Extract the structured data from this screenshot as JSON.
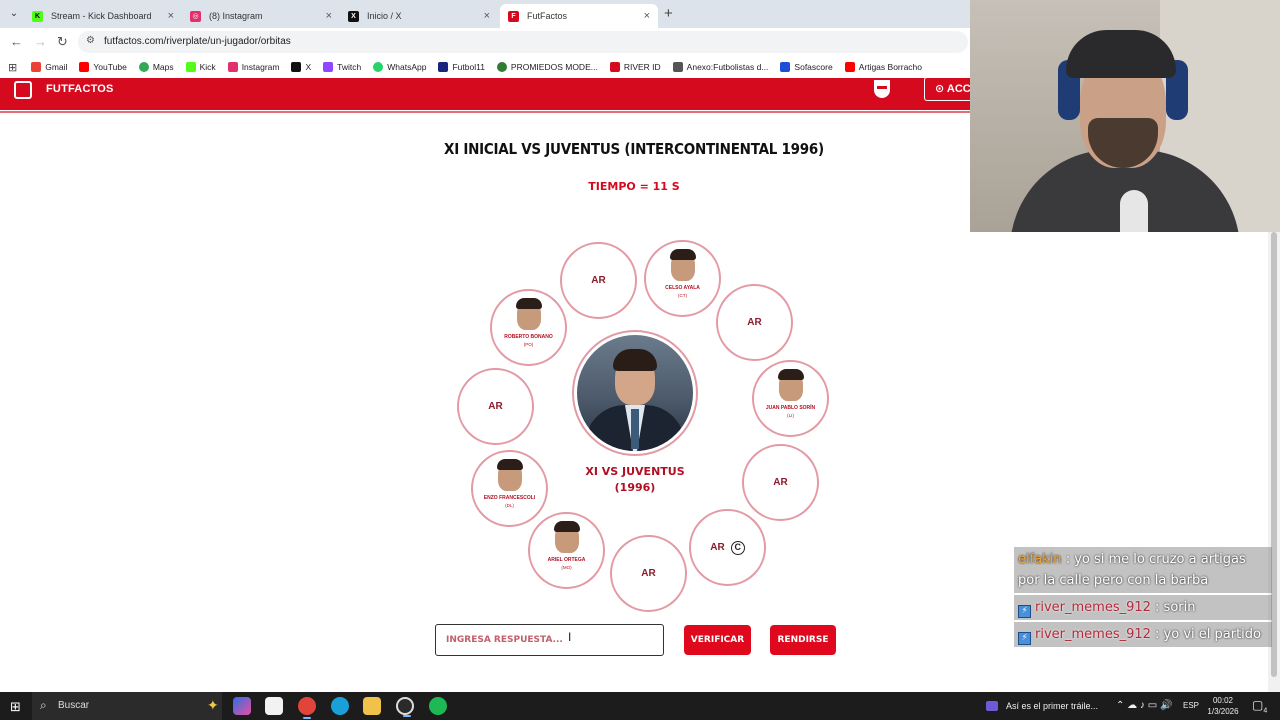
{
  "browser": {
    "tabs": [
      {
        "label": "Stream - Kick Dashboard",
        "color": "#53fc18"
      },
      {
        "label": "(8) Instagram",
        "color": "#e1306c"
      },
      {
        "label": "Inicio / X",
        "color": "#111111"
      },
      {
        "label": "FutFactos",
        "color": "#d50a1e"
      }
    ],
    "url": "futfactos.com/riverplate/un-jugador/orbitas"
  },
  "bookmarks": [
    {
      "label": "Gmail",
      "color": "#ea4335"
    },
    {
      "label": "YouTube",
      "color": "#ff0000"
    },
    {
      "label": "Maps",
      "color": "#34a853"
    },
    {
      "label": "Kick",
      "color": "#53fc18"
    },
    {
      "label": "Instagram",
      "color": "#e1306c"
    },
    {
      "label": "X",
      "color": "#111111"
    },
    {
      "label": "Twitch",
      "color": "#9146ff"
    },
    {
      "label": "WhatsApp",
      "color": "#25d366"
    },
    {
      "label": "Futbol11",
      "color": "#1a237e"
    },
    {
      "label": "PROMIEDOS MODE...",
      "color": "#2e7d32"
    },
    {
      "label": "RIVER ID",
      "color": "#d50a1e"
    },
    {
      "label": "Anexo:Futbolistas d...",
      "color": "#555555"
    },
    {
      "label": "Sofascore",
      "color": "#1d4ed8"
    },
    {
      "label": "Artigas Borracho",
      "color": "#ff0000"
    }
  ],
  "site": {
    "logo_text": "FUTFACTOS",
    "access_label": "ACCEDER",
    "accent": "#d50a1e"
  },
  "game": {
    "title": "XI INICIAL VS JUVENTUS (INTERCONTINENTAL 1996)",
    "timer": "TIEMPO = 11 S",
    "center_label_line1": "XI VS JUVENTUS",
    "center_label_line2": "(1996)",
    "hidden_label": "AR",
    "players": [
      {
        "name": "CELSO AYALA",
        "pos": "(CT)"
      },
      {
        "name": "JUAN PABLO SORÍN",
        "pos": "(LI)"
      },
      {
        "name": "ROBERTO BONANO",
        "pos": "(PO)"
      },
      {
        "name": "ENZO FRANCESCOLI",
        "pos": "(DL)"
      },
      {
        "name": "ARIEL ORTEGA",
        "pos": "(MO)"
      }
    ],
    "input_placeholder": "INGRESA RESPUESTA...",
    "verify_label": "VERIFICAR",
    "surrender_label": "RENDIRSE"
  },
  "chat": [
    {
      "user": "elfakin",
      "text": ": yo si me lo cruzo a artigas por la calle pero con la barba"
    },
    {
      "user": "river_memes_912",
      "text": ": sorin"
    },
    {
      "user": "river_memes_912",
      "text": ": yo vi el partido"
    }
  ],
  "taskbar": {
    "search_label": "Buscar",
    "notification": "Así es el primer tráile...",
    "lang": "ESP",
    "time": "00:02",
    "date": "1/3/2026",
    "badge": "4"
  }
}
